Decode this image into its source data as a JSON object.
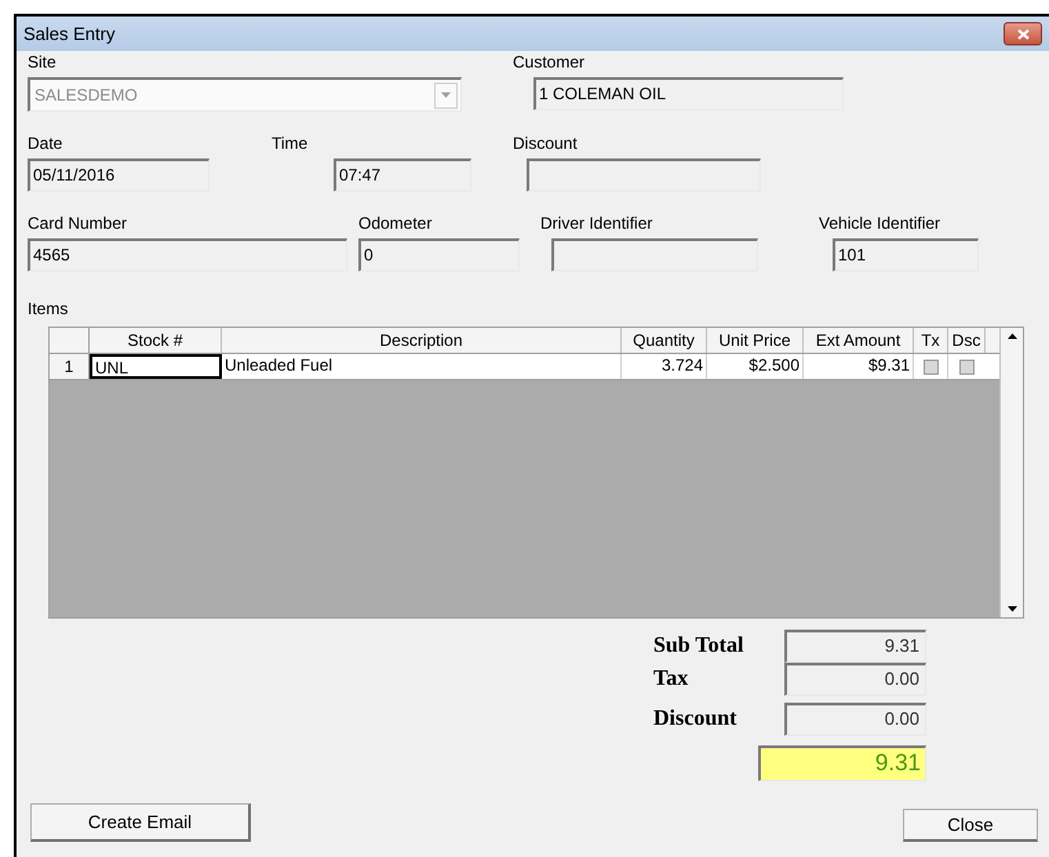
{
  "window": {
    "title": "Sales Entry"
  },
  "field_rows": [
    {
      "fields": [
        {
          "label": "Site",
          "value": "SALESDEMO",
          "kind": "combo",
          "disabled": true
        },
        {
          "label": "Customer",
          "value": "1 COLEMAN OIL",
          "kind": "text",
          "disabled": false
        }
      ]
    },
    {
      "fields": [
        {
          "label": "Date",
          "value": "05/11/2016",
          "kind": "text",
          "disabled": false
        },
        {
          "label": "Time",
          "value": "07:47",
          "kind": "text",
          "disabled": false
        },
        {
          "label": "Discount",
          "kind": "text",
          "disabled": false
        }
      ]
    },
    {
      "fields": [
        {
          "label": "Card Number",
          "value": "4565",
          "kind": "text",
          "disabled": false
        },
        {
          "label": "Odometer",
          "value": "0",
          "kind": "text",
          "disabled": false
        },
        {
          "label": "Driver Identifier",
          "kind": "text",
          "disabled": false
        },
        {
          "label": "Vehicle Identifier",
          "value": "101",
          "kind": "text",
          "disabled": false
        }
      ]
    }
  ],
  "items": {
    "label": "Items",
    "columns": [
      "Stock #",
      "Description",
      "Quantity",
      "Unit Price",
      "Ext Amount",
      "Tx",
      "Dsc"
    ],
    "rows": [
      {
        "number": "1",
        "stock": "UNL",
        "description": "Unleaded Fuel",
        "quantity": "3.724",
        "unit_price": "$2.500",
        "ext_amount": "$9.31",
        "tx": false,
        "dsc": false
      }
    ]
  },
  "totals": [
    {
      "label": "Sub Total",
      "value": "9.31"
    },
    {
      "label": "Tax",
      "value": "0.00"
    },
    {
      "label": "Discount",
      "value": "0.00"
    }
  ],
  "grand_total": "9.31",
  "buttons": [
    "Create Email",
    "Close"
  ]
}
